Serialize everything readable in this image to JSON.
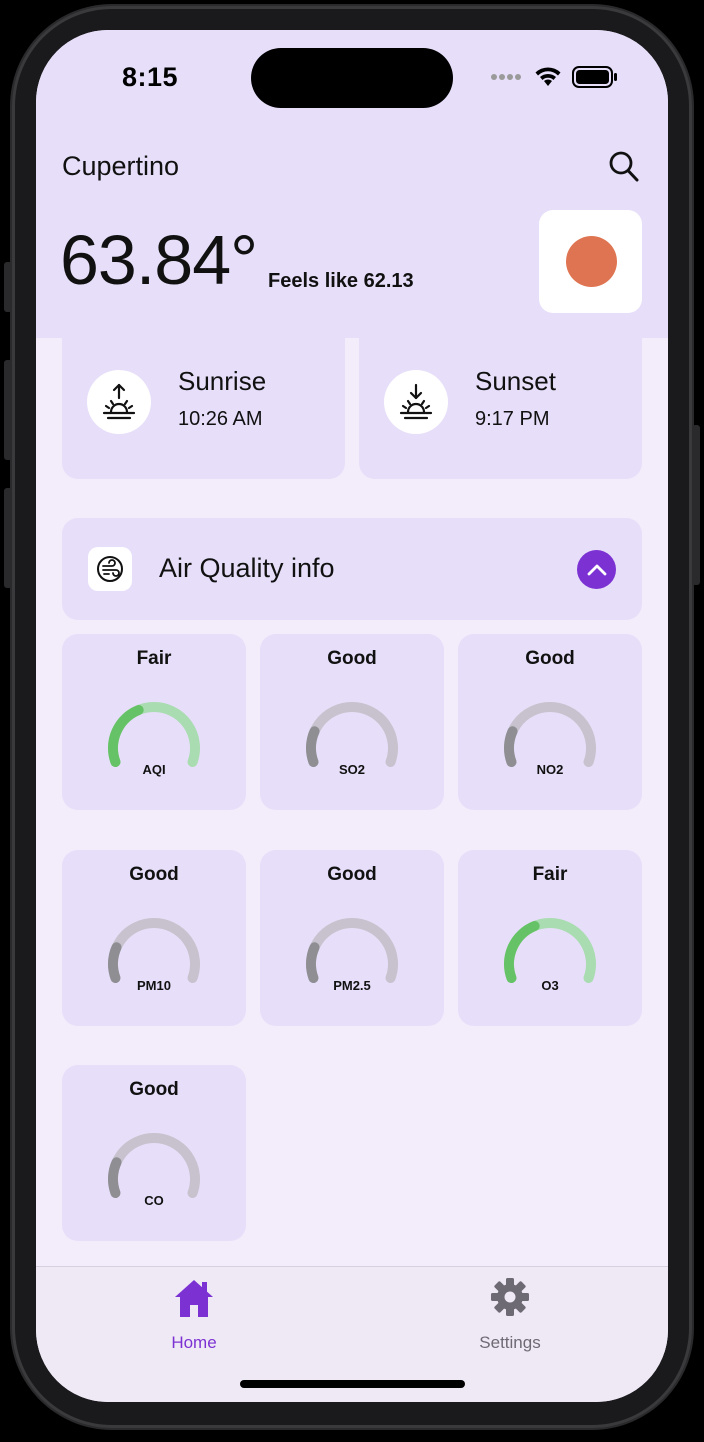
{
  "status_bar": {
    "time": "8:15"
  },
  "header": {
    "city": "Cupertino",
    "temperature": "63.84°",
    "feels_like": "Feels like 62.13",
    "weather_icon_color": "#de7451"
  },
  "sun": {
    "sunrise": {
      "title": "Sunrise",
      "time": "10:26 AM",
      "icon": "sunrise-icon"
    },
    "sunset": {
      "title": "Sunset",
      "time": "9:17 PM",
      "icon": "sunset-icon"
    }
  },
  "air_quality": {
    "title": "Air Quality info",
    "icon": "wind-icon",
    "toggle_icon": "chevron-up-icon",
    "accent_color": "#7c32d3",
    "gauges": [
      {
        "status": "Fair",
        "label": "AQI",
        "level": 0.4
      },
      {
        "status": "Good",
        "label": "SO2",
        "level": 0.2
      },
      {
        "status": "Good",
        "label": "NO2",
        "level": 0.2
      },
      {
        "status": "Good",
        "label": "PM10",
        "level": 0.2
      },
      {
        "status": "Good",
        "label": "PM2.5",
        "level": 0.2
      },
      {
        "status": "Fair",
        "label": "O3",
        "level": 0.4
      },
      {
        "status": "Good",
        "label": "CO",
        "level": 0.2
      }
    ],
    "colors": {
      "fair_fill": "#66c266",
      "fair_track": "#a9dcb0",
      "good_fill": "#8e8e93",
      "good_track": "#c7c2cd"
    }
  },
  "tabbar": {
    "tabs": [
      {
        "label": "Home",
        "icon": "home-icon",
        "active": true
      },
      {
        "label": "Settings",
        "icon": "gear-icon",
        "active": false
      }
    ],
    "active_color": "#7c32d3",
    "inactive_color": "#6e6a73"
  }
}
